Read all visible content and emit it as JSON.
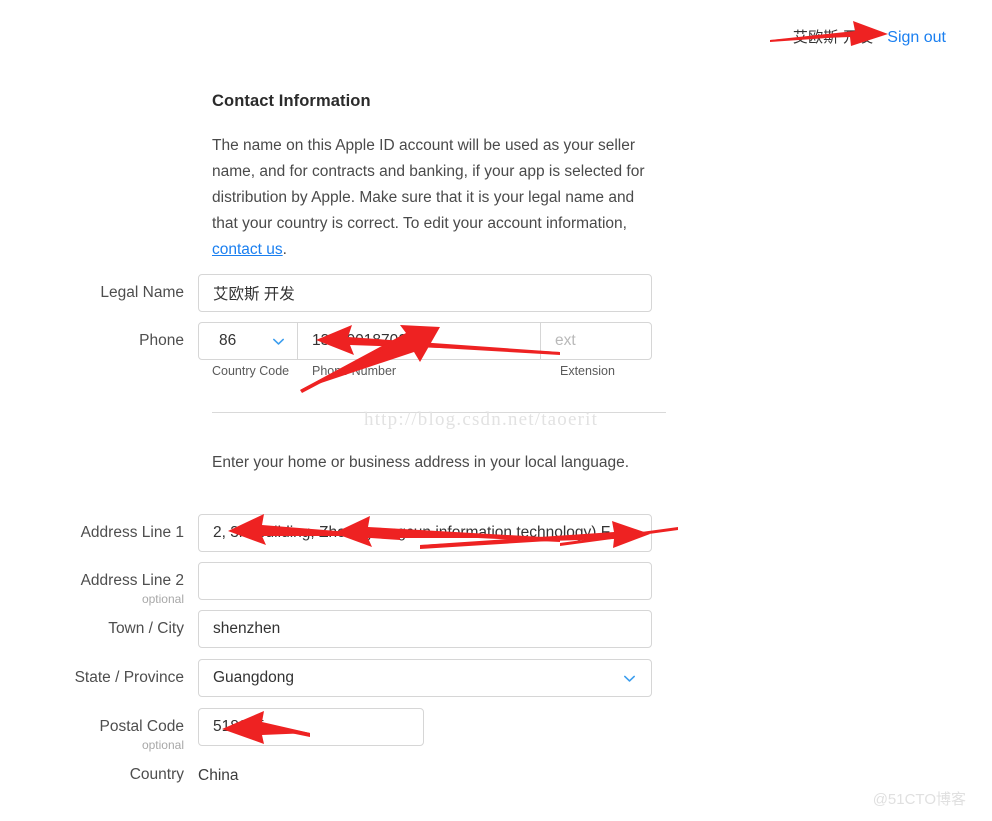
{
  "header": {
    "account_name": "艾欧斯 开发",
    "signout_label": "Sign out"
  },
  "section": {
    "title": "Contact Information",
    "description_part1": "The name on this Apple ID account will be used as your seller name, and for contracts and banking, if your app is selected for distribution by Apple. Make sure that it is your legal name and that your country is correct. To edit your account information, ",
    "contact_link": "contact us",
    "description_end": "."
  },
  "form": {
    "legal_name": {
      "label": "Legal Name",
      "value": "艾欧斯 开发"
    },
    "phone": {
      "label": "Phone",
      "country_code": "86",
      "number": "13590018700",
      "ext_placeholder": "ext",
      "ext_value": "",
      "sublabel_country_code": "Country Code",
      "sublabel_number": "Phone Number",
      "sublabel_extension": "Extension"
    },
    "address_help": "Enter your home or business address in your local language.",
    "address_line1": {
      "label": "Address Line 1",
      "value": "2, 3rd building, Zhongguangcun information technology) F"
    },
    "address_line2": {
      "label": "Address Line 2",
      "optional": "optional",
      "value": ""
    },
    "town_city": {
      "label": "Town / City",
      "value": "shenzhen"
    },
    "state_province": {
      "label": "State / Province",
      "value": "Guangdong"
    },
    "postal_code": {
      "label": "Postal Code",
      "optional": "optional",
      "value": "518055"
    },
    "country": {
      "label": "Country",
      "value": "China"
    }
  },
  "watermarks": {
    "url": "http://blog.csdn.net/taoerit",
    "site": "@51CTO博客"
  },
  "colors": {
    "link": "#1a7ff0",
    "annotation_arrow": "#ee2222",
    "border": "#d6d6d6"
  }
}
